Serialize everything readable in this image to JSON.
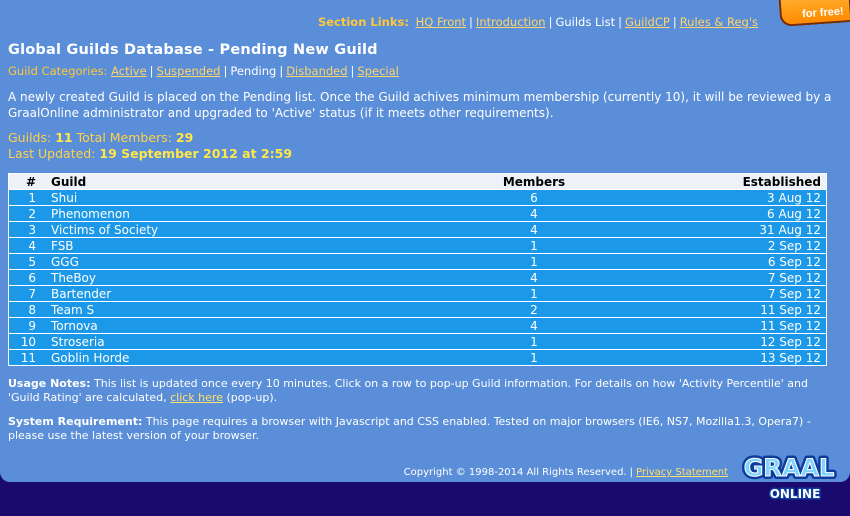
{
  "promo": {
    "text": "for free!"
  },
  "section_links": {
    "lead": "Section Links:",
    "items": [
      {
        "label": "HQ Front",
        "current": false
      },
      {
        "label": "Introduction",
        "current": false
      },
      {
        "label": "Guilds List",
        "current": true
      },
      {
        "label": "GuildCP",
        "current": false
      },
      {
        "label": "Rules & Reg's",
        "current": false
      }
    ]
  },
  "page_title": "Global Guilds Database - Pending New Guild",
  "categories": {
    "lead": "Guild Categories:",
    "items": [
      {
        "label": "Active",
        "current": false
      },
      {
        "label": "Suspended",
        "current": false
      },
      {
        "label": "Pending",
        "current": true
      },
      {
        "label": "Disbanded",
        "current": false
      },
      {
        "label": "Special",
        "current": false
      }
    ]
  },
  "intro": "A newly created Guild is placed on the Pending list. Once the Guild achives minimum membership (currently 10), it will be reviewed by a GraalOnline administrator and upgraded to 'Active' status (if it meets other requirements).",
  "stats": {
    "guilds_label": "Guilds:",
    "guilds_value": "11",
    "members_label": "Total Members:",
    "members_value": "29",
    "updated_label": "Last Updated:",
    "updated_value": "19 September 2012 at 2:59"
  },
  "table": {
    "headers": {
      "num": "#",
      "guild": "Guild",
      "members": "Members",
      "established": "Established"
    },
    "rows": [
      {
        "num": "1",
        "guild": "Shui",
        "members": "6",
        "established": "3 Aug 12"
      },
      {
        "num": "2",
        "guild": "Phenomenon",
        "members": "4",
        "established": "6 Aug 12"
      },
      {
        "num": "3",
        "guild": "Victims of Society",
        "members": "4",
        "established": "31 Aug 12"
      },
      {
        "num": "4",
        "guild": "FSB",
        "members": "1",
        "established": "2 Sep 12"
      },
      {
        "num": "5",
        "guild": "GGG",
        "members": "1",
        "established": "6 Sep 12"
      },
      {
        "num": "6",
        "guild": "TheBoy",
        "members": "4",
        "established": "7 Sep 12"
      },
      {
        "num": "7",
        "guild": "Bartender",
        "members": "1",
        "established": "7 Sep 12"
      },
      {
        "num": "8",
        "guild": "Team S",
        "members": "2",
        "established": "11 Sep 12"
      },
      {
        "num": "9",
        "guild": "Tornova",
        "members": "4",
        "established": "11 Sep 12"
      },
      {
        "num": "10",
        "guild": "Stroseria",
        "members": "1",
        "established": "12 Sep 12"
      },
      {
        "num": "11",
        "guild": "Goblin Horde",
        "members": "1",
        "established": "13 Sep 12"
      }
    ]
  },
  "usage_notes": {
    "label": "Usage Notes:",
    "text": " This list is updated once every 10 minutes. Click on a row to pop-up Guild information. For details on how 'Activity Percentile' and 'Guild Rating' are calculated, ",
    "link": "click here",
    "after": " (pop-up)."
  },
  "system_requirement": {
    "label": "System Requirement:",
    "text": " This page requires a browser with Javascript and CSS enabled. Tested on major browsers (IE6, NS7, Mozilla1.3, Opera7) - please use the latest version of your browser."
  },
  "footer": {
    "copyright": "Copyright © 1998-2014 All Rights Reserved.",
    "sep": "|",
    "privacy": "Privacy Statement"
  },
  "logo": {
    "line1": "GRAAL",
    "line2": "ONLINE"
  },
  "colors": {
    "background": "#1b0a6e",
    "panel": "#5a8ed8",
    "row": "#1c98e8",
    "header_row": "#eef2f8",
    "accent_gold": "#ffc83a"
  }
}
